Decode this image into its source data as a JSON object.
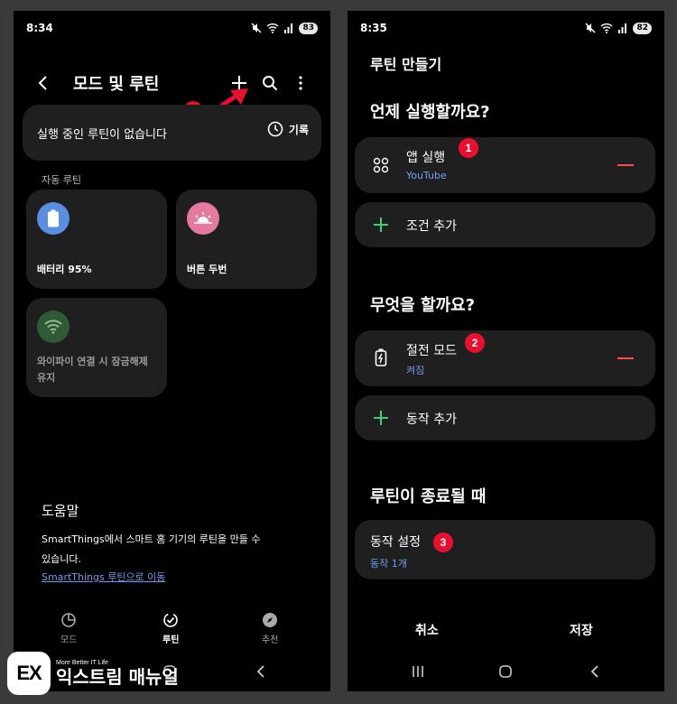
{
  "left": {
    "status": {
      "time": "8:34",
      "battery": "83"
    },
    "app_bar": {
      "title": "모드 및 루틴"
    },
    "running": {
      "text": "실행 중인 루틴이 없습니다",
      "history_label": "기록"
    },
    "auto_section_label": "자동 루틴",
    "routines": [
      {
        "label": "배터리 95%",
        "icon": "battery-icon",
        "color": "#5b8de0"
      },
      {
        "label": "버튼 두번",
        "icon": "sunrise-icon",
        "color": "#e47aa0"
      },
      {
        "label": "와이파이 연결 시 잠금해제\n유지",
        "icon": "wifi-icon",
        "color": "#2f5a35"
      }
    ],
    "help": {
      "title": "도움말",
      "body": "SmartThings에서 스마트 홈 기기의 루틴을 만들 수\n있습니다.",
      "link": "SmartThings 루틴으로 이동"
    },
    "bottom_nav": [
      {
        "label": "모드",
        "icon": "mode-icon"
      },
      {
        "label": "루틴",
        "icon": "routine-check-icon"
      },
      {
        "label": "추천",
        "icon": "compass-icon"
      }
    ],
    "marker": "1"
  },
  "right": {
    "status": {
      "time": "8:35",
      "battery": "82"
    },
    "header": "루틴 만들기",
    "when_title": "언제 실행할까요?",
    "when_row": {
      "title": "앱 실행",
      "sub": "YouTube",
      "marker": "1"
    },
    "add_condition": "조건 추가",
    "what_title": "무엇을 할까요?",
    "what_row": {
      "title": "절전 모드",
      "sub": "켜짐",
      "marker": "2"
    },
    "add_action": "동작 추가",
    "end_title": "루틴이 종료될 때",
    "end_row": {
      "title": "동작 설정",
      "sub": "동작 1개",
      "marker": "3"
    },
    "cancel": "취소",
    "save": "저장"
  },
  "watermark": {
    "logo_letters": "EX",
    "tagline": "More Better IT Life",
    "brand": "익스트림 매뉴얼"
  },
  "colors": {
    "accent_blue": "#6f9cf2",
    "accent_green": "#3fcf7a",
    "marker_red": "#e8102e",
    "card_bg": "#1f1f1f"
  }
}
